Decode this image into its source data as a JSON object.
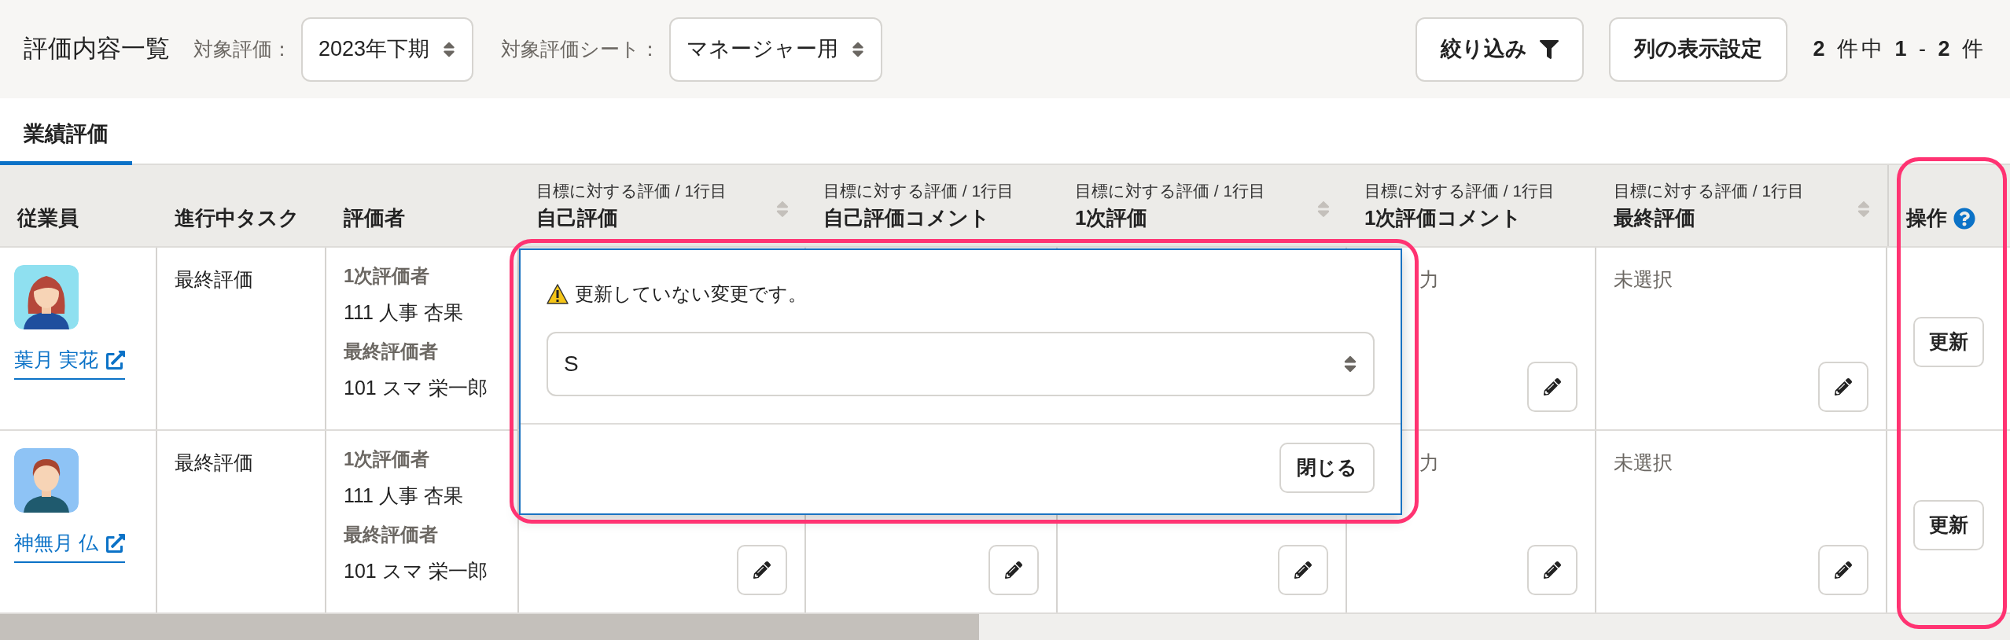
{
  "header": {
    "title": "評価内容一覧",
    "filters": [
      {
        "label": "対象評価：",
        "value": "2023年下期"
      },
      {
        "label": "対象評価シート：",
        "value": "マネージャー用"
      }
    ],
    "buttons": [
      {
        "kind": "filter",
        "label": "絞り込み"
      },
      {
        "kind": "plain",
        "label": "列の表示設定"
      }
    ],
    "count": "**2** 件中 **1** - **2** 件"
  },
  "tabs": [
    {
      "label": "業績評価",
      "selected": true
    }
  ],
  "table": {
    "columns": [
      {
        "label": "従業員"
      },
      {
        "label": "進行中タスク"
      },
      {
        "label": "評価者"
      },
      {
        "sublabel": "目標に対する評価 / 1行目",
        "label": "自己評価",
        "sortable": true
      },
      {
        "sublabel": "目標に対する評価 / 1行目",
        "label": "自己評価コメント",
        "sortable": false
      },
      {
        "sublabel": "目標に対する評価 / 1行目",
        "label": "1次評価",
        "sortable": true
      },
      {
        "sublabel": "目標に対する評価 / 1行目",
        "label": "1次評価コメント",
        "sortable": false
      },
      {
        "sublabel": "目標に対する評価 / 1行目",
        "label": "最終評価",
        "sortable": true
      },
      {
        "label": "操作",
        "help": true
      }
    ],
    "rows": [
      {
        "employee": {
          "name": "葉月 実花",
          "avatar": {
            "kind": "woman"
          }
        },
        "task": "最終評価",
        "evaluators": [
          {
            "role": "1次評価者",
            "name": "111 人事 杏果"
          },
          {
            "role": "最終評価者",
            "name": "101 スマ 栄一郎"
          }
        ],
        "grades": [
          {
            "text": "力",
            "edit": true
          },
          {
            "text": "未選択",
            "edit": true
          }
        ],
        "action": "更新"
      },
      {
        "employee": {
          "name": "神無月 仏",
          "avatar": {
            "kind": "man"
          }
        },
        "task": "最終評価",
        "evaluators": [
          {
            "role": "1次評価者",
            "name": "111 人事 杏果"
          },
          {
            "role": "最終評価者",
            "name": "101 スマ 栄一郎"
          }
        ],
        "grades": [
          {
            "edit": true
          },
          {
            "edit": true
          },
          {
            "edit": true
          },
          {
            "text": "力",
            "edit": true
          },
          {
            "text": "未選択",
            "edit": true
          }
        ],
        "action": "更新"
      }
    ]
  },
  "popover": {
    "warning": "更新していない変更です。",
    "value": "S",
    "close": "閉じる"
  }
}
